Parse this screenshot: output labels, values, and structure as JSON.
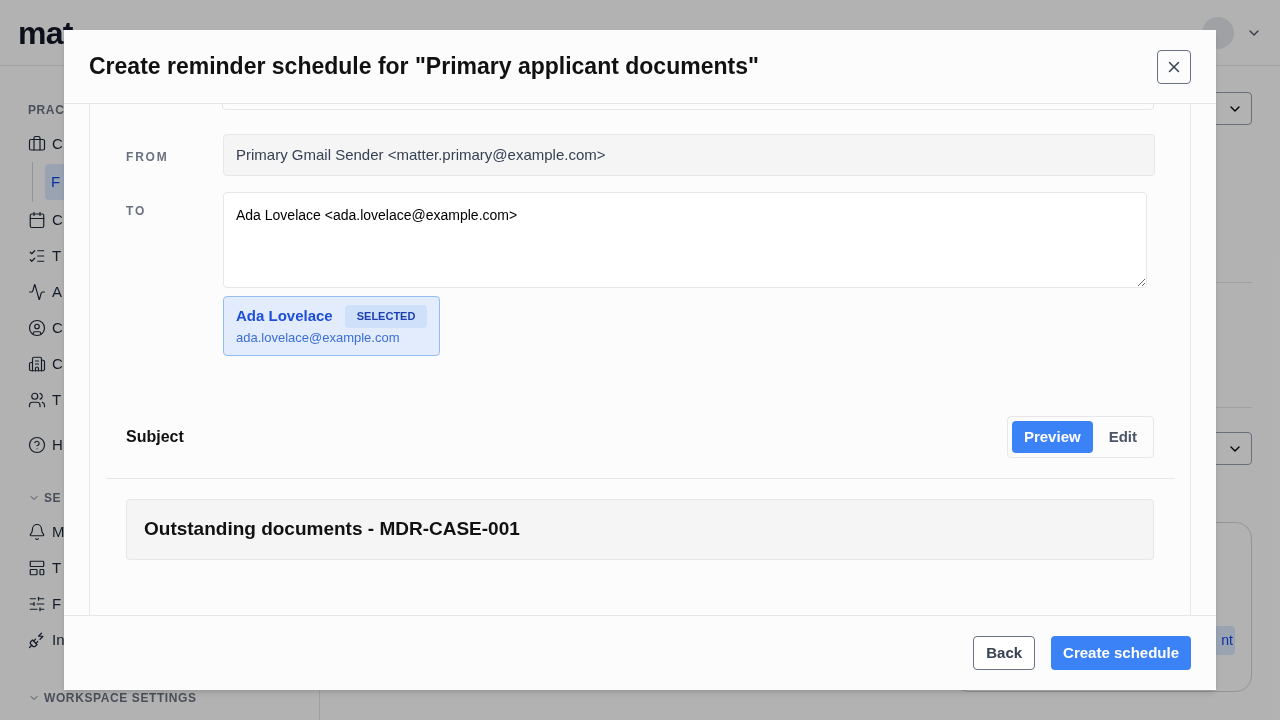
{
  "app": {
    "logo": "mat",
    "sidebar": {
      "sections": [
        {
          "label": "PRAC",
          "collapsible": false,
          "items": [
            {
              "label": "C",
              "selected": false,
              "children": [
                {
                  "label": "F",
                  "selected": true
                }
              ]
            },
            {
              "label": "C",
              "selected": false
            },
            {
              "label": "T",
              "selected": false
            },
            {
              "label": "A",
              "selected": false
            },
            {
              "label": "C",
              "selected": false
            },
            {
              "label": "C",
              "selected": false
            },
            {
              "label": "T",
              "selected": false
            },
            {
              "label": "H",
              "selected": false
            }
          ]
        },
        {
          "label": "SE",
          "collapsible": true,
          "items": [
            {
              "label": "M",
              "selected": false
            },
            {
              "label": "T",
              "selected": false
            },
            {
              "label": "F",
              "selected": false
            },
            {
              "label": "In",
              "selected": false
            }
          ]
        },
        {
          "label": "WORKSPACE SETTINGS",
          "collapsible": true
        }
      ]
    },
    "badge": "nt"
  },
  "modal": {
    "title": "Create reminder schedule for \"Primary applicant documents\"",
    "from": {
      "label": "FROM",
      "value": "Primary Gmail Sender <matter.primary@example.com>"
    },
    "to": {
      "label": "TO",
      "value": "Ada Lovelace <ada.lovelace@example.com>"
    },
    "recipients": [
      {
        "name": "Ada Lovelace",
        "email": "ada.lovelace@example.com",
        "badge": "SELECTED",
        "selected": true
      }
    ],
    "subject": {
      "label": "Subject",
      "tabs": [
        {
          "label": "Preview",
          "selected": true
        },
        {
          "label": "Edit",
          "selected": false
        }
      ],
      "preview": "Outstanding documents - MDR-CASE-001"
    },
    "buttons": [
      {
        "label": "Back",
        "kind": "secondary"
      },
      {
        "label": "Create schedule",
        "kind": "primary"
      }
    ]
  }
}
